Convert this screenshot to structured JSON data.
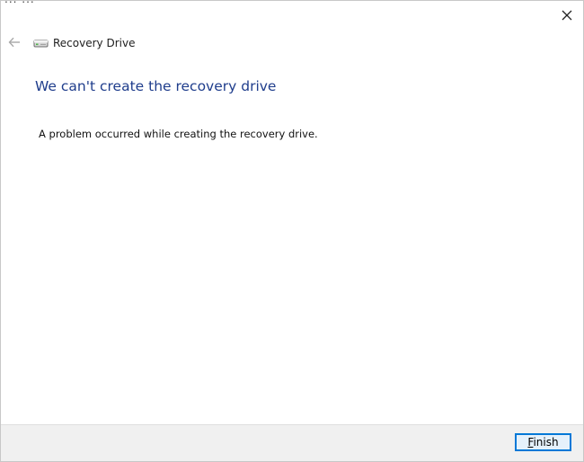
{
  "stray_text": "... ...",
  "window": {
    "title": "Recovery Drive",
    "icon": "drive-icon",
    "close_icon": "close-icon",
    "back_icon": "back-arrow-icon"
  },
  "main": {
    "heading": "We can't create the recovery drive",
    "message": "A problem occurred while creating the recovery drive."
  },
  "footer": {
    "finish_label_mnemonic": "F",
    "finish_label_rest": "inish"
  },
  "colors": {
    "heading": "#1f3d8c",
    "accent": "#0078d7",
    "footer_bg": "#f0f0f0"
  }
}
